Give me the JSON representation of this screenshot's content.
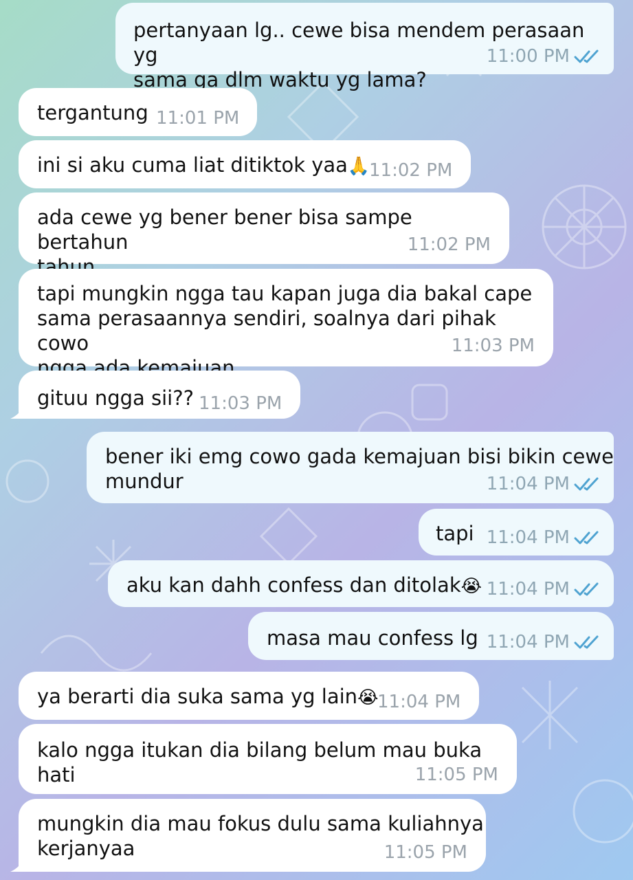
{
  "messages": [
    {
      "dir": "out",
      "text": "pertanyaan lg.. cewe bisa mendem perasaan yg\nsama ga dlm waktu yg lama?",
      "time": "11:00 PM",
      "read": true
    },
    {
      "dir": "in",
      "text": "tergantung",
      "time": "11:01 PM"
    },
    {
      "dir": "in",
      "text": "ini si aku cuma liat ditiktok yaa",
      "emoji": "🙏",
      "time": "11:02 PM"
    },
    {
      "dir": "in",
      "text": "ada cewe yg bener bener bisa sampe bertahun\ntahun",
      "time": "11:02 PM"
    },
    {
      "dir": "in",
      "text": "tapi mungkin ngga tau kapan juga dia bakal cape\nsama perasaannya sendiri, soalnya dari pihak cowo\nngga ada kemajuan",
      "time": "11:03 PM"
    },
    {
      "dir": "in",
      "text": "gituu ngga sii??",
      "time": "11:03 PM"
    },
    {
      "dir": "out",
      "text": "bener iki emg cowo gada kemajuan bisi bikin cewe\nmundur",
      "time": "11:04 PM",
      "read": true
    },
    {
      "dir": "out",
      "text": "tapi",
      "time": "11:04 PM",
      "read": true
    },
    {
      "dir": "out",
      "text": "aku kan dahh confess dan ditolak",
      "emoji": "😭",
      "time": "11:04 PM",
      "read": true
    },
    {
      "dir": "out",
      "text": "masa mau confess lg",
      "time": "11:04 PM",
      "read": true
    },
    {
      "dir": "in",
      "text": "ya berarti dia suka sama yg lain",
      "emoji": "😭",
      "time": "11:04 PM"
    },
    {
      "dir": "in",
      "text": "kalo ngga itukan dia bilang belum mau buka hati",
      "time": "11:05 PM"
    },
    {
      "dir": "in",
      "text": "mungkin dia mau fokus dulu sama kuliahnya\nkerjanyaa",
      "time": "11:05 PM"
    }
  ],
  "colors": {
    "incoming": "#ffffff",
    "outgoing": "#eff9fd",
    "check": "#4fa3d1",
    "time": "#9aa3ab"
  },
  "icons": {
    "read": "double-check-icon"
  }
}
